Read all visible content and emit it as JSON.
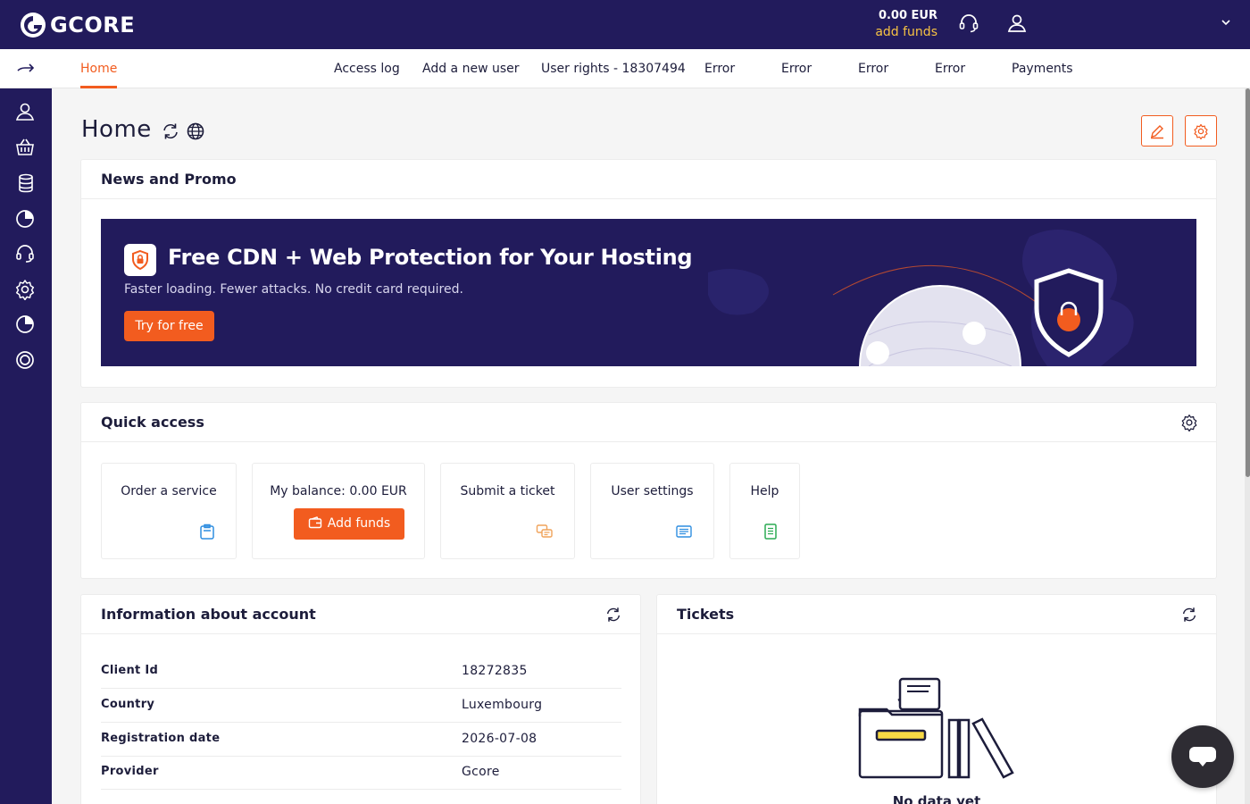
{
  "header": {
    "logo_text": "GCORE",
    "balance_amount": "0.00 EUR",
    "add_funds_link": "add funds"
  },
  "tabs": [
    {
      "label": "Home",
      "active": true
    },
    {
      "label": "Access log"
    },
    {
      "label": "Add a new user"
    },
    {
      "label": "User rights - 18307494"
    },
    {
      "label": "Error"
    },
    {
      "label": "Error"
    },
    {
      "label": "Error"
    },
    {
      "label": "Error"
    },
    {
      "label": "Payments"
    }
  ],
  "sidebar": {
    "icons": [
      "user-icon",
      "basket-icon",
      "database-icon",
      "pie-chart-icon",
      "headset-icon",
      "gear-icon",
      "pie-chart-icon",
      "lifebuoy-icon"
    ]
  },
  "page": {
    "title": "Home"
  },
  "news": {
    "title": "News and Promo",
    "banner_title": "Free CDN + Web Protection for Your Hosting",
    "banner_subtitle": "Faster loading. Fewer attacks. No credit card required.",
    "banner_button": "Try for free"
  },
  "quick_access": {
    "title": "Quick access",
    "tiles": [
      {
        "label": "Order a service",
        "icon": "clipboard-icon"
      },
      {
        "label": "My balance: 0.00 EUR",
        "button": "Add funds"
      },
      {
        "label": "Submit a ticket",
        "icon": "chat-icon"
      },
      {
        "label": "User settings",
        "icon": "settings-list-icon"
      },
      {
        "label": "Help",
        "icon": "document-icon"
      }
    ]
  },
  "account_info": {
    "title": "Information about account",
    "rows": [
      {
        "key": "Client Id",
        "value": "18272835"
      },
      {
        "key": "Country",
        "value": "Luxembourg"
      },
      {
        "key": "Registration date",
        "value": "2026-07-08"
      },
      {
        "key": "Provider",
        "value": "Gcore"
      }
    ]
  },
  "tickets": {
    "title": "Tickets",
    "empty_text": "No data yet"
  },
  "colors": {
    "brand_dark": "#221b5c",
    "accent": "#f25c1f",
    "funds_yellow": "#f6c243"
  }
}
